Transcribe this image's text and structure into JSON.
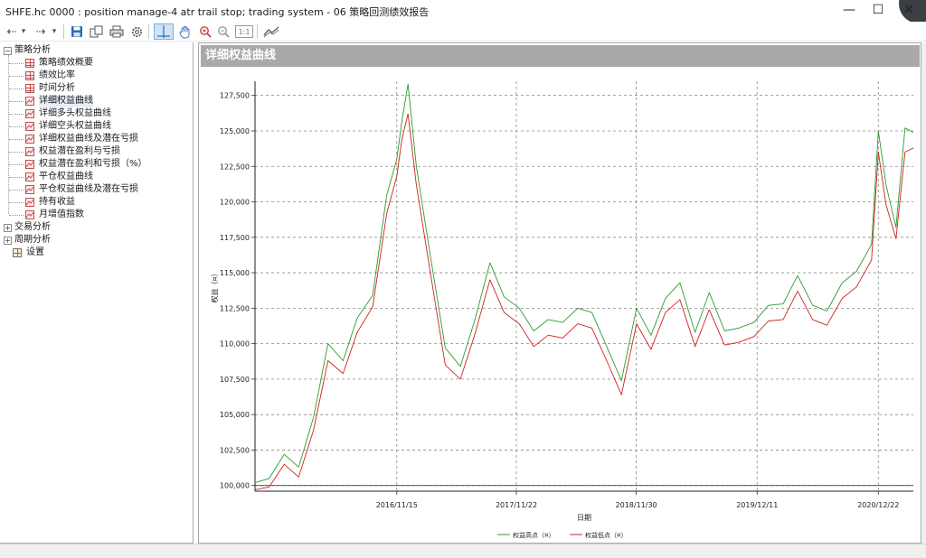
{
  "window": {
    "title": "SHFE.hc 0000 : position manage-4 atr trail stop; trading system - 06 策略回测绩效报告",
    "minimize_glyph": "—",
    "maximize_glyph": "☐",
    "close_glyph": "✕"
  },
  "toolbar": {
    "back_glyph": "⇠",
    "forward_glyph": "⇢",
    "dropdown_glyph": "▾",
    "save_icon": "floppy-disk-icon",
    "copy_icon": "copy-icon",
    "print_icon": "printer-icon",
    "settings_icon": "gear-icon",
    "crosshair_icon": "crosshair-icon",
    "pan_icon": "hand-icon",
    "zoom_in_icon": "zoom-in-icon",
    "zoom_out_icon": "zoom-out-icon",
    "fit_label": "1:1",
    "chart_icon": "chart-style-icon"
  },
  "tree": {
    "root_label": "策略分析",
    "root_items": [
      "策略绩效概要",
      "绩效比率",
      "时间分析",
      "详细权益曲线",
      "详细多头权益曲线",
      "详细空头权益曲线",
      "详细权益曲线及潜在亏损",
      "权益潜在盈利与亏损",
      "权益潜在盈利和亏损（%）",
      "平仓权益曲线",
      "平仓权益曲线及潜在亏损",
      "持有收益",
      "月增值指数"
    ],
    "selected_index": 3,
    "groups": [
      "交易分析",
      "周期分析"
    ],
    "settings_label": "设置"
  },
  "panel": {
    "title": "详细权益曲线"
  },
  "chart_data": {
    "type": "line",
    "title": "",
    "xlabel": "日期",
    "ylabel": "权益（¤）",
    "ylim": [
      99600,
      128500
    ],
    "yticks": [
      100000,
      102500,
      105000,
      107500,
      110000,
      112500,
      115000,
      117500,
      120000,
      122500,
      125000,
      127500
    ],
    "ytick_labels": [
      "100,000",
      "102,500",
      "105,000",
      "107,500",
      "110,000",
      "112,500",
      "115,000",
      "117,500",
      "120,000",
      "122,500",
      "125,000",
      "127,500"
    ],
    "xlim": [
      "2015-09-01",
      "2021-04-10"
    ],
    "xticks": [
      "2016-11-15",
      "2017-11-22",
      "2018-11-30",
      "2019-12-11",
      "2020-12-22"
    ],
    "xtick_labels": [
      "2016/11/15",
      "2017/11/22",
      "2018/11/30",
      "2019/12/11",
      "2020/12/22"
    ],
    "grid": true,
    "legend": "bottom",
    "series": [
      {
        "name": "权益高点（¤）",
        "color": "#2e9a2e",
        "x": [
          "2015-09-01",
          "2015-10-15",
          "2015-12-01",
          "2016-01-15",
          "2016-03-01",
          "2016-04-15",
          "2016-06-01",
          "2016-07-15",
          "2016-09-01",
          "2016-10-15",
          "2016-11-15",
          "2016-12-01",
          "2016-12-20",
          "2017-01-15",
          "2017-03-01",
          "2017-04-15",
          "2017-06-01",
          "2017-07-15",
          "2017-09-01",
          "2017-10-15",
          "2017-12-01",
          "2018-01-15",
          "2018-03-01",
          "2018-04-15",
          "2018-06-01",
          "2018-07-15",
          "2018-09-01",
          "2018-10-15",
          "2018-12-01",
          "2019-01-15",
          "2019-03-01",
          "2019-04-15",
          "2019-06-01",
          "2019-07-15",
          "2019-09-01",
          "2019-10-15",
          "2019-12-01",
          "2020-01-15",
          "2020-03-01",
          "2020-04-15",
          "2020-06-01",
          "2020-07-15",
          "2020-09-01",
          "2020-10-15",
          "2020-12-01",
          "2020-12-22",
          "2021-01-15",
          "2021-02-15",
          "2021-03-15",
          "2021-04-10"
        ],
        "values": [
          100200,
          100500,
          102200,
          101300,
          104800,
          110000,
          108800,
          111800,
          113400,
          120500,
          123000,
          125700,
          128300,
          122500,
          116000,
          109700,
          108400,
          111600,
          115700,
          113300,
          112500,
          110900,
          111700,
          111500,
          112500,
          112200,
          109700,
          107400,
          112500,
          110600,
          113200,
          114300,
          110800,
          113600,
          110900,
          111100,
          111500,
          112700,
          112800,
          114800,
          112700,
          112300,
          114300,
          115100,
          117000,
          125000,
          121200,
          118200,
          125200,
          124900
        ]
      },
      {
        "name": "权益低点（¤）",
        "color": "#d02020",
        "x": [
          "2015-09-01",
          "2015-10-15",
          "2015-12-01",
          "2016-01-15",
          "2016-03-01",
          "2016-04-15",
          "2016-06-01",
          "2016-07-15",
          "2016-09-01",
          "2016-10-15",
          "2016-11-15",
          "2016-12-01",
          "2016-12-20",
          "2017-01-15",
          "2017-03-01",
          "2017-04-15",
          "2017-06-01",
          "2017-07-15",
          "2017-09-01",
          "2017-10-15",
          "2017-12-01",
          "2018-01-15",
          "2018-03-01",
          "2018-04-15",
          "2018-06-01",
          "2018-07-15",
          "2018-09-01",
          "2018-10-15",
          "2018-12-01",
          "2019-01-15",
          "2019-03-01",
          "2019-04-15",
          "2019-06-01",
          "2019-07-15",
          "2019-09-01",
          "2019-10-15",
          "2019-12-01",
          "2020-01-15",
          "2020-03-01",
          "2020-04-15",
          "2020-06-01",
          "2020-07-15",
          "2020-09-01",
          "2020-10-15",
          "2020-12-01",
          "2020-12-22",
          "2021-01-15",
          "2021-02-15",
          "2021-03-15",
          "2021-04-10"
        ],
        "values": [
          99700,
          99900,
          101500,
          100600,
          103900,
          108800,
          107900,
          110800,
          112600,
          119200,
          121800,
          124400,
          126200,
          121200,
          114800,
          108500,
          107500,
          110600,
          114500,
          112200,
          111400,
          109800,
          110600,
          110400,
          111400,
          111100,
          108700,
          106400,
          111400,
          109600,
          112200,
          113100,
          109800,
          112400,
          109900,
          110100,
          110500,
          111600,
          111700,
          113700,
          111700,
          111300,
          113200,
          114000,
          115900,
          123500,
          119800,
          117400,
          123500,
          123800
        ]
      }
    ]
  }
}
